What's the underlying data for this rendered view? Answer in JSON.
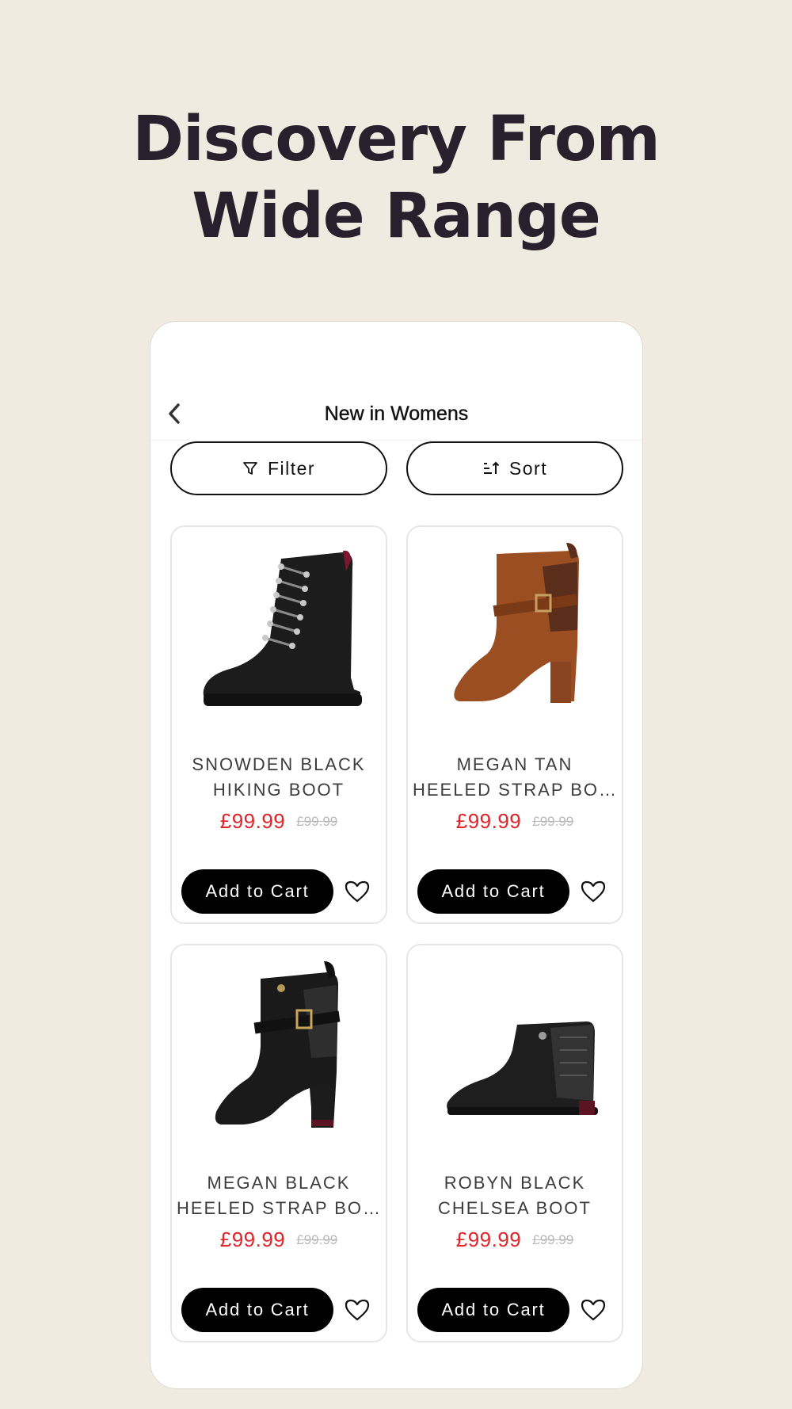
{
  "hero": {
    "line1": "Discovery From",
    "line2": "Wide Range"
  },
  "nav": {
    "title": "New in Womens",
    "back_icon": "chevron-left-icon"
  },
  "toolbar": {
    "filter_label": "Filter",
    "filter_icon": "filter-icon",
    "sort_label": "Sort",
    "sort_icon": "sort-icon"
  },
  "products": [
    {
      "name_line1": "SNOWDEN BLACK",
      "name_line2": "HIKING BOOT",
      "price": "£99.99",
      "old_price": "£99.99",
      "add_label": "Add to Cart",
      "image": "black-hiking-boot",
      "color": "#1c1c1c"
    },
    {
      "name_line1": "MEGAN TAN",
      "name_line2": "HEELED STRAP BO...",
      "price": "£99.99",
      "old_price": "£99.99",
      "add_label": "Add to Cart",
      "image": "tan-heeled-strap-boot",
      "color": "#9a4e22"
    },
    {
      "name_line1": "MEGAN BLACK",
      "name_line2": "HEELED STRAP BO...",
      "price": "£99.99",
      "old_price": "£99.99",
      "add_label": "Add to Cart",
      "image": "black-heeled-strap-boot",
      "color": "#1a1a1a"
    },
    {
      "name_line1": "ROBYN BLACK",
      "name_line2": "CHELSEA BOOT",
      "price": "£99.99",
      "old_price": "£99.99",
      "add_label": "Add to Cart",
      "image": "black-chelsea-boot",
      "color": "#1e1e1e"
    }
  ],
  "colors": {
    "background": "#efebe0",
    "heading": "#2a1f2c",
    "price": "#e0242a",
    "button": "#000000"
  }
}
